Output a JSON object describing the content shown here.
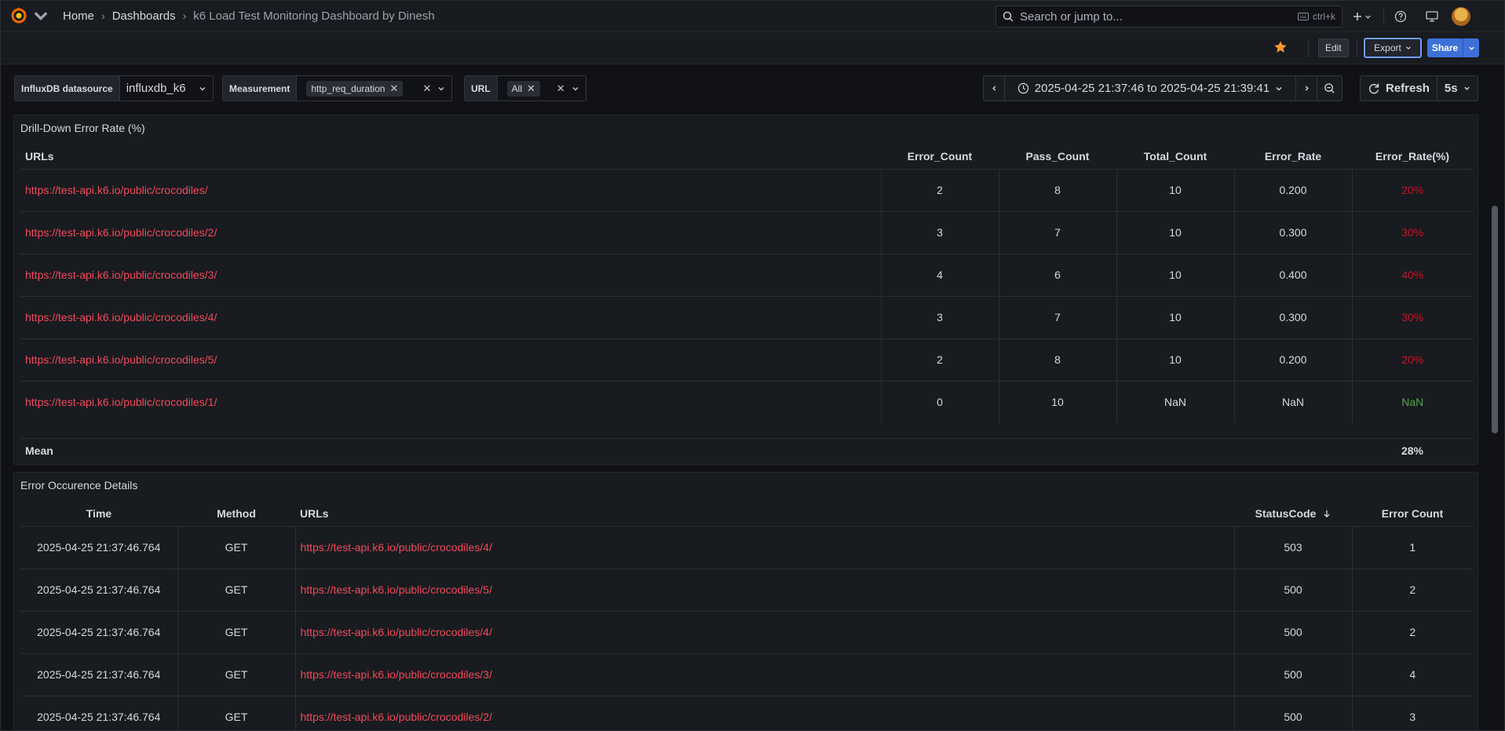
{
  "topbar": {
    "breadcrumbs": [
      "Home",
      "Dashboards",
      "k6 Load Test Monitoring Dashboard by Dinesh"
    ],
    "search_placeholder": "Search or jump to...",
    "search_shortcut": "ctrl+k"
  },
  "toolbar": {
    "edit_label": "Edit",
    "export_label": "Export",
    "share_label": "Share"
  },
  "variables": [
    {
      "label": "InfluxDB datasource",
      "value": "influxdb_k6"
    },
    {
      "label": "Measurement",
      "value": "http_req_duration"
    },
    {
      "label": "URL",
      "value": "All"
    }
  ],
  "time_picker": {
    "range": "2025-04-25 21:37:46 to 2025-04-25 21:39:41",
    "refresh_label": "Refresh",
    "refresh_interval": "5s"
  },
  "panel1": {
    "title": "Drill-Down Error Rate (%)",
    "columns": [
      "URLs",
      "Error_Count",
      "Pass_Count",
      "Total_Count",
      "Error_Rate",
      "Error_Rate(%)"
    ],
    "rows": [
      {
        "url": "https://test-api.k6.io/public/crocodiles/",
        "error_count": "2",
        "pass_count": "8",
        "total_count": "10",
        "error_rate": "0.200",
        "error_pct": "20%"
      },
      {
        "url": "https://test-api.k6.io/public/crocodiles/2/",
        "error_count": "3",
        "pass_count": "7",
        "total_count": "10",
        "error_rate": "0.300",
        "error_pct": "30%"
      },
      {
        "url": "https://test-api.k6.io/public/crocodiles/3/",
        "error_count": "4",
        "pass_count": "6",
        "total_count": "10",
        "error_rate": "0.400",
        "error_pct": "40%"
      },
      {
        "url": "https://test-api.k6.io/public/crocodiles/4/",
        "error_count": "3",
        "pass_count": "7",
        "total_count": "10",
        "error_rate": "0.300",
        "error_pct": "30%"
      },
      {
        "url": "https://test-api.k6.io/public/crocodiles/5/",
        "error_count": "2",
        "pass_count": "8",
        "total_count": "10",
        "error_rate": "0.200",
        "error_pct": "20%"
      },
      {
        "url": "https://test-api.k6.io/public/crocodiles/1/",
        "error_count": "0",
        "pass_count": "10",
        "total_count": "NaN",
        "error_rate": "NaN",
        "error_pct": "NaN"
      }
    ],
    "footer_label": "Mean",
    "footer_value": "28%"
  },
  "panel2": {
    "title": "Error Occurence Details",
    "columns": [
      "Time",
      "Method",
      "URLs",
      "StatusCode",
      "Error Count"
    ],
    "rows": [
      {
        "time": "2025-04-25 21:37:46.764",
        "method": "GET",
        "url": "https://test-api.k6.io/public/crocodiles/4/",
        "status": "503",
        "count": "1"
      },
      {
        "time": "2025-04-25 21:37:46.764",
        "method": "GET",
        "url": "https://test-api.k6.io/public/crocodiles/5/",
        "status": "500",
        "count": "2"
      },
      {
        "time": "2025-04-25 21:37:46.764",
        "method": "GET",
        "url": "https://test-api.k6.io/public/crocodiles/4/",
        "status": "500",
        "count": "2"
      },
      {
        "time": "2025-04-25 21:37:46.764",
        "method": "GET",
        "url": "https://test-api.k6.io/public/crocodiles/3/",
        "status": "500",
        "count": "4"
      },
      {
        "time": "2025-04-25 21:37:46.764",
        "method": "GET",
        "url": "https://test-api.k6.io/public/crocodiles/2/",
        "status": "500",
        "count": "3"
      }
    ]
  },
  "colors": {
    "background": "#111217",
    "panel": "#181b1f",
    "url_link": "#f2495c",
    "error_red": "#c4162a",
    "ok_green": "#56a64b",
    "primary_blue": "#3d71d9",
    "star": "#ff9830"
  }
}
